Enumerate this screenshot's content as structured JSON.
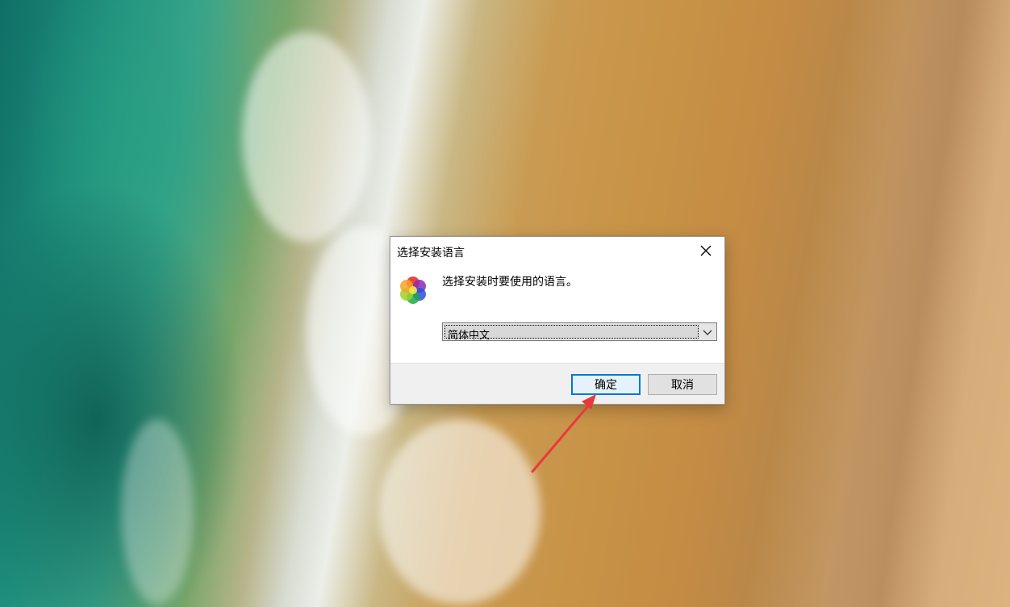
{
  "dialog": {
    "title": "选择安装语言",
    "prompt": "选择安装时要使用的语言。",
    "language_select": {
      "selected": "简体中文"
    },
    "buttons": {
      "ok": "确定",
      "cancel": "取消"
    },
    "icons": {
      "app": "multicolor-flower-icon",
      "close": "close-icon",
      "dropdown": "chevron-down-icon"
    }
  },
  "annotation": {
    "arrow_color": "#e83a3a"
  },
  "colors": {
    "accent": "#0078d7"
  }
}
